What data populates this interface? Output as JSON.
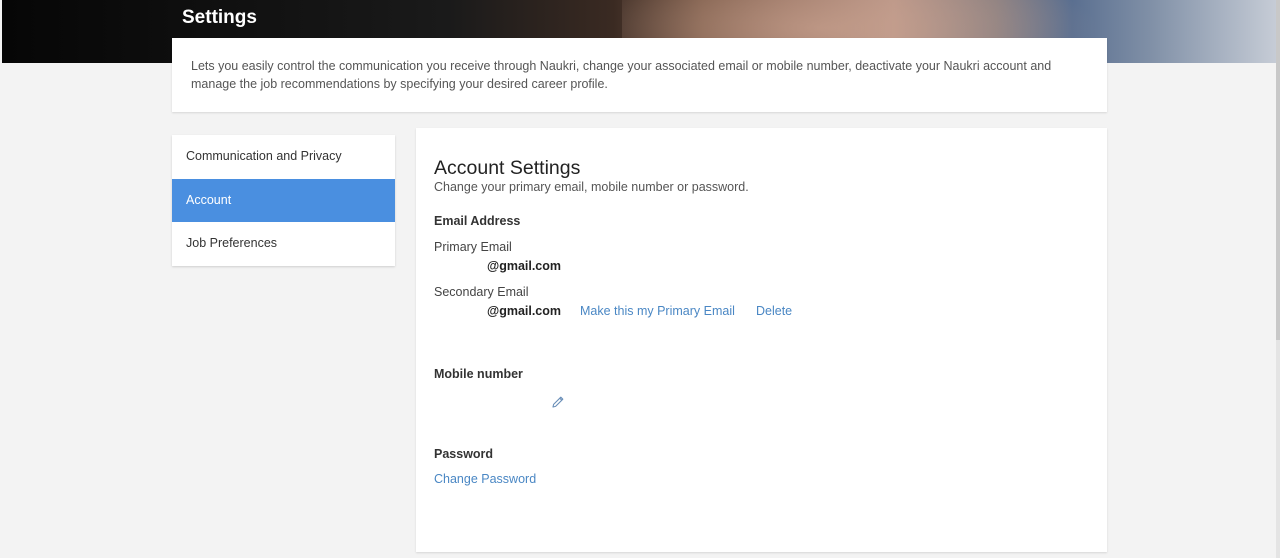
{
  "header": {
    "title": "Settings",
    "intro": "Lets you easily control the communication you receive through Naukri, change your associated email or mobile number, deactivate your Naukri account and manage the job recommendations by specifying your desired career profile."
  },
  "sidebar": {
    "items": [
      {
        "label": "Communication and Privacy",
        "active": false
      },
      {
        "label": "Account",
        "active": true
      },
      {
        "label": "Job Preferences",
        "active": false
      }
    ]
  },
  "account": {
    "title": "Account Settings",
    "subtitle": "Change your primary email, mobile number or password.",
    "email_section": "Email Address",
    "primary_label": "Primary Email",
    "primary_value": "@gmail.com",
    "secondary_label": "Secondary Email",
    "secondary_value": "@gmail.com",
    "make_primary": "Make this my Primary Email",
    "delete": "Delete",
    "mobile_section": "Mobile number",
    "mobile_edit_icon": "pencil-icon",
    "password_section": "Password",
    "change_password": "Change Password"
  },
  "colors": {
    "accent": "#4a8fe0",
    "link": "#4a87c4",
    "background": "#f3f3f3"
  }
}
